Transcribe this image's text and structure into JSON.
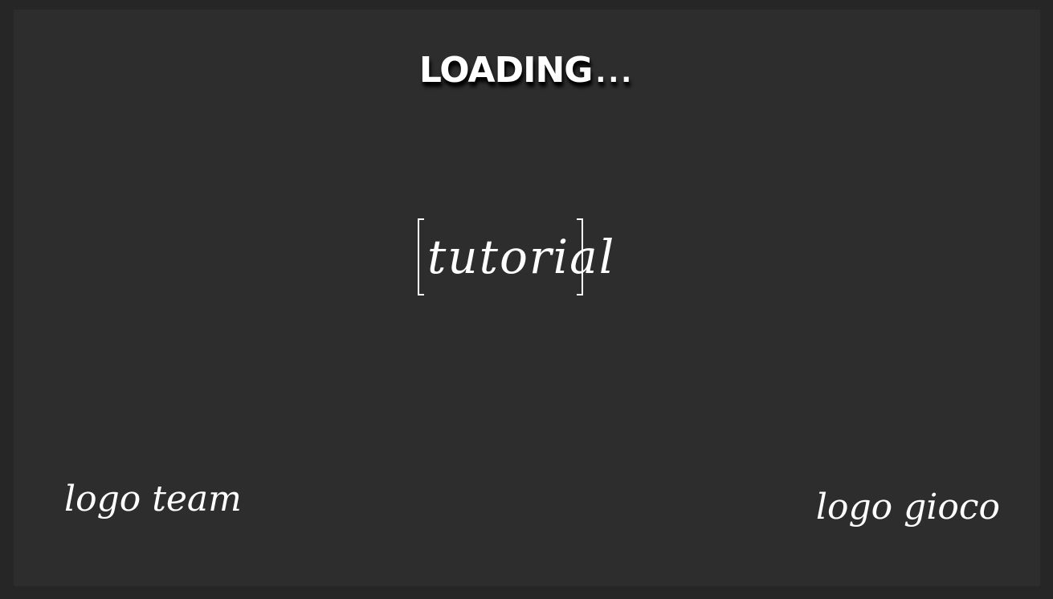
{
  "loading": {
    "label": "LOADING",
    "dots": "..."
  },
  "tutorial": {
    "label": "tutorial"
  },
  "logos": {
    "team": "logo team",
    "game": "logo gioco"
  },
  "colors": {
    "background": "#2d2d2d",
    "border": "#262626",
    "text": "#ffffff"
  }
}
